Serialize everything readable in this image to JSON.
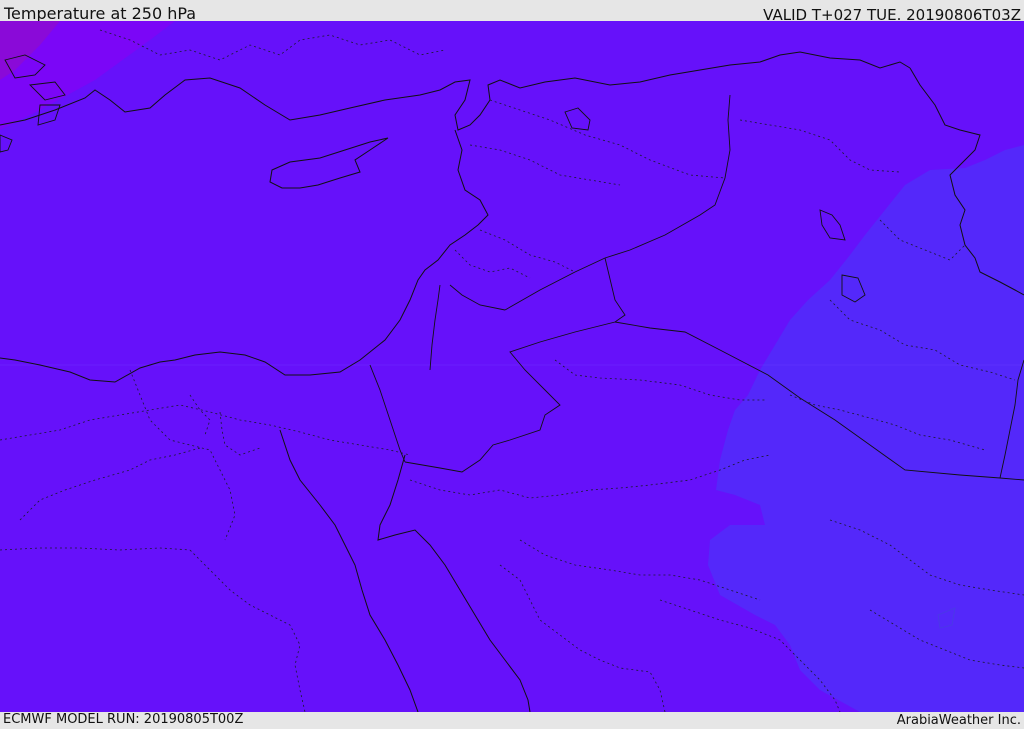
{
  "header": {
    "title": "Temperature at 250 hPa",
    "valid_time": "VALID T+027 TUE. 20190806T03Z"
  },
  "footer": {
    "model_run": "ECMWF MODEL RUN: 20190805T00Z",
    "credit": "ArabiaWeather Inc."
  },
  "map": {
    "variable": "temperature",
    "pressure_level_hpa": 250,
    "colors": {
      "main_field": "#6611fa",
      "cooler_band": "#7b06f7",
      "coldest_corner": "#8a0ad8",
      "warmer_zone": "#5428fa",
      "coastline": "#111111",
      "border_dotted": "#1a1a2e"
    }
  }
}
